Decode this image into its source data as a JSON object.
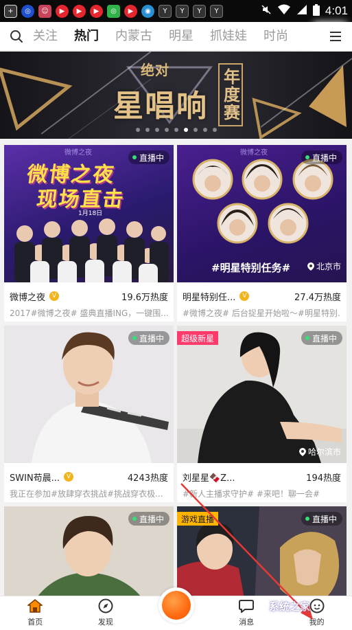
{
  "status_bar": {
    "time": "4:01",
    "notification_icons": [
      "tv-app-icon",
      "headset-app-icon",
      "contact-app-icon",
      "video-app-icon",
      "video-app-icon",
      "video-app-icon",
      "wechat-icon",
      "video-app-icon",
      "browser-icon",
      "y-app-icon",
      "y-app-icon",
      "y-app-icon",
      "y-app-icon",
      "y-app-icon"
    ],
    "system_icons": [
      "mute-icon",
      "wifi-icon",
      "signal-icon",
      "battery-icon"
    ]
  },
  "top_nav": {
    "tabs": [
      {
        "label": "关注",
        "active": false
      },
      {
        "label": "热门",
        "active": true
      },
      {
        "label": "内蒙古",
        "active": false
      },
      {
        "label": "明星",
        "active": false
      },
      {
        "label": "抓娃娃",
        "active": false
      },
      {
        "label": "时尚",
        "active": false
      }
    ]
  },
  "banner": {
    "title_small": "绝对",
    "title_big": "星唱响",
    "badge": "年度赛",
    "slide_count": 9,
    "active_slide": 6
  },
  "cards": [
    {
      "name": "微博之夜",
      "verified": true,
      "heat": "19.6万热度",
      "desc": "2017#微博之夜# 盛典直播ING，一键围...",
      "live_label": "直播中",
      "poster_line1": "微博之夜",
      "poster_line2": "现场直击",
      "poster_date": "1月18日",
      "poster_logo": "微博之夜"
    },
    {
      "name": "明星特别任...",
      "verified": true,
      "heat": "27.4万热度",
      "desc": "#微博之夜# 后台捉星开始啦～#明星特别...",
      "live_label": "直播中",
      "poster_text": "#明星特别任务#",
      "poster_logo": "微博之夜",
      "location": "北京市"
    },
    {
      "name": "SWIN苟晨...",
      "verified": true,
      "heat": "4243热度",
      "desc": "我正在参加#放肆穿衣挑战#挑战穿衣极...",
      "live_label": "直播中"
    },
    {
      "name": "刘星星🍫Z...",
      "verified": false,
      "heat": "194热度",
      "desc": "#新人主播求守护# #来吧！聊一会#",
      "live_label": "直播中",
      "tag": "超级新星",
      "location": "哈尔滨市"
    },
    {
      "live_label": "直播中"
    },
    {
      "live_label": "直播中",
      "tag": "游戏直播"
    }
  ],
  "bottom_nav": {
    "items": [
      {
        "label": "首页",
        "icon": "home-icon",
        "active": true
      },
      {
        "label": "发现",
        "icon": "compass-icon",
        "active": false
      },
      {
        "label": "",
        "icon": "live-icon",
        "active": false
      },
      {
        "label": "消息",
        "icon": "message-icon",
        "active": false
      },
      {
        "label": "我的",
        "icon": "profile-icon",
        "active": false
      }
    ]
  },
  "watermark": "系统之家",
  "colors": {
    "accent": "#ff8a00",
    "live_dot": "#35e07a",
    "new_star_tag": "#ff3b6b",
    "game_tag": "#ffb400",
    "verified": "#f3b41e",
    "banner_gold": "#e2c289"
  }
}
